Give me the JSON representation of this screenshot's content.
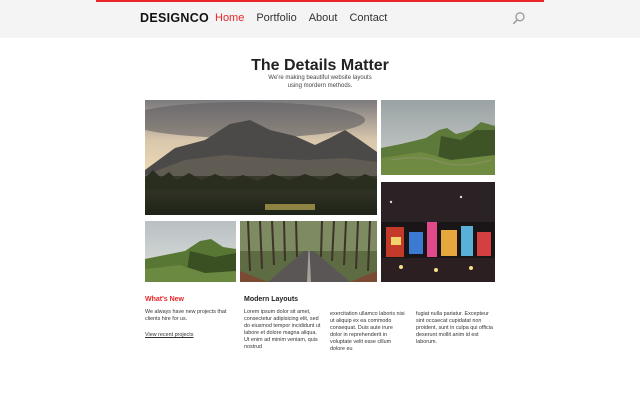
{
  "brand": {
    "name": "DESIGNCO",
    "accent_color": "#e8262a"
  },
  "nav": {
    "items": [
      {
        "label": "Home",
        "active": true
      },
      {
        "label": "Portfolio",
        "active": false
      },
      {
        "label": "About",
        "active": false
      },
      {
        "label": "Contact",
        "active": false
      }
    ],
    "search_icon": "search-icon"
  },
  "hero": {
    "title": "The Details Matter",
    "subtitle_line1": "We're making beautiful website layouts",
    "subtitle_line2": "using mordern methods."
  },
  "gallery": {
    "photos": [
      {
        "subject": "mountain-forest-sunset"
      },
      {
        "subject": "green-hills-landscape"
      },
      {
        "subject": "city-street-night-billboards"
      },
      {
        "subject": "green-cliff-landscape"
      },
      {
        "subject": "tree-lined-road"
      }
    ]
  },
  "whats_new": {
    "heading": "What's New",
    "text": "We always have new projects that clients hire for us.",
    "link": "View recent projects"
  },
  "modern_layouts": {
    "heading": "Modern Layouts",
    "col1": "Lorem ipsum dolor sit amet, consectetur adipisicing elit, sed do eiusmod tempor incididunt ut labore et dolore magna aliqua. Ut enim ad minim veniam, quis nostrud",
    "col2": "exercitation ullamco laboris nisi ut aliquip ex ea commodo consequat. Duis aute irure dolor in reprehenderit in voluptate velit esse cillum dolore eu",
    "col3": "fugiat nulla pariatur. Excepteur sint occaecat cupidatat non proident, sunt in culpa qui officia deserunt mollit anim id est laborum."
  }
}
